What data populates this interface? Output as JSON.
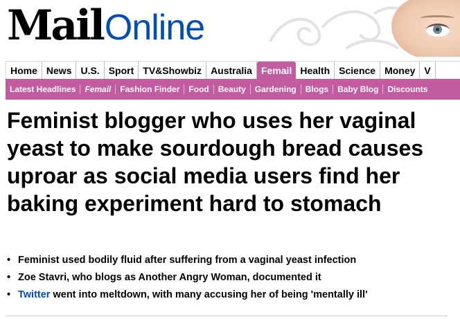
{
  "masthead": {
    "logo_mail": "Mail",
    "logo_online": "Online"
  },
  "nav": {
    "items": [
      {
        "label": "Home"
      },
      {
        "label": "News"
      },
      {
        "label": "U.S."
      },
      {
        "label": "Sport"
      },
      {
        "label": "TV&Showbiz"
      },
      {
        "label": "Australia"
      },
      {
        "label": "Femail",
        "active": true
      },
      {
        "label": "Health"
      },
      {
        "label": "Science"
      },
      {
        "label": "Money"
      },
      {
        "label": "V"
      }
    ]
  },
  "subnav": {
    "items": [
      {
        "label": "Latest Headlines"
      },
      {
        "label": "Femail",
        "active": true
      },
      {
        "label": "Fashion Finder"
      },
      {
        "label": "Food"
      },
      {
        "label": "Beauty"
      },
      {
        "label": "Gardening"
      },
      {
        "label": "Blogs"
      },
      {
        "label": "Baby Blog"
      },
      {
        "label": "Discounts"
      }
    ]
  },
  "article": {
    "headline": "Feminist blogger who uses her vaginal yeast to make sourdough bread causes uproar as social media users find her baking experiment hard to stomach",
    "bullets": [
      {
        "text": "Feminist used bodily fluid after suffering from a vaginal yeast infection"
      },
      {
        "text": "Zoe Stavri, who blogs as Another Angry Woman, documented it"
      },
      {
        "link": "Twitter",
        "text": " went into meltdown, with many accusing her of being 'mentally ill'"
      }
    ]
  },
  "colors": {
    "femail_pink": "#c25ba0",
    "online_blue": "#004db3",
    "link_blue": "#004db3"
  }
}
